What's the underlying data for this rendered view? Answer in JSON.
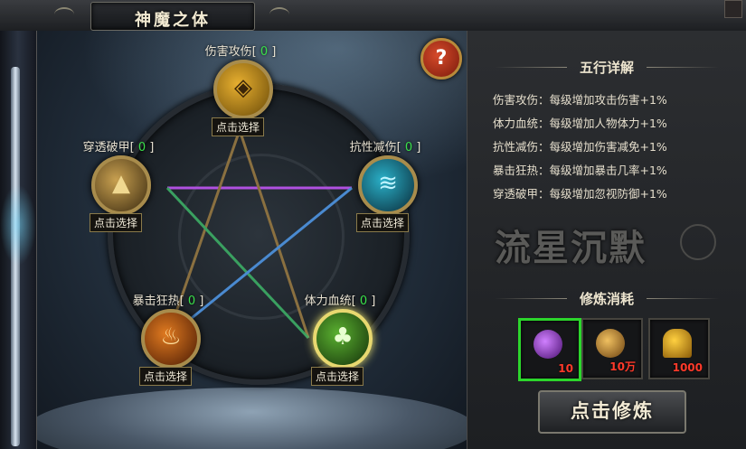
{
  "window": {
    "title": "神魔之体"
  },
  "help": {
    "symbol": "?"
  },
  "nodes": [
    {
      "key": "damage",
      "name": "伤害攻伤",
      "level": "0",
      "button": "点击选择",
      "glyph": "◈",
      "color": "#e0b020"
    },
    {
      "key": "pierce",
      "name": "穿透破甲",
      "level": "0",
      "button": "点击选择",
      "glyph": "▲",
      "color": "#c8a040"
    },
    {
      "key": "resist",
      "name": "抗性减伤",
      "level": "0",
      "button": "点击选择",
      "glyph": "≋",
      "color": "#3ac8d8"
    },
    {
      "key": "crit",
      "name": "暴击狂热",
      "level": "0",
      "button": "点击选择",
      "glyph": "♨",
      "color": "#e87a20"
    },
    {
      "key": "vitality",
      "name": "体力血统",
      "level": "0",
      "button": "点击选择",
      "glyph": "♣",
      "color": "#68c838"
    }
  ],
  "details": {
    "title": "五行详解",
    "lines": [
      "伤害攻伤：每级增加攻击伤害+1%",
      "体力血统：每级增加人物体力+1%",
      "抗性减伤：每级增加伤害减免+1%",
      "暴击狂热：每级增加暴击几率+1%",
      "穿透破甲：每级增加忽视防御+1%"
    ]
  },
  "watermark": {
    "text": "流星沉默"
  },
  "cost": {
    "title": "修炼消耗",
    "items": [
      {
        "name": "purple-gem-icon",
        "count": "10",
        "selected": true,
        "color": "#9a3ad8"
      },
      {
        "name": "gold-coin-icon",
        "count": "10万",
        "selected": false,
        "color": "#d8a030"
      },
      {
        "name": "gold-ingot-icon",
        "count": "1000",
        "selected": false,
        "color": "#e8b020"
      }
    ]
  },
  "actions": {
    "train_label": "点击修炼"
  }
}
